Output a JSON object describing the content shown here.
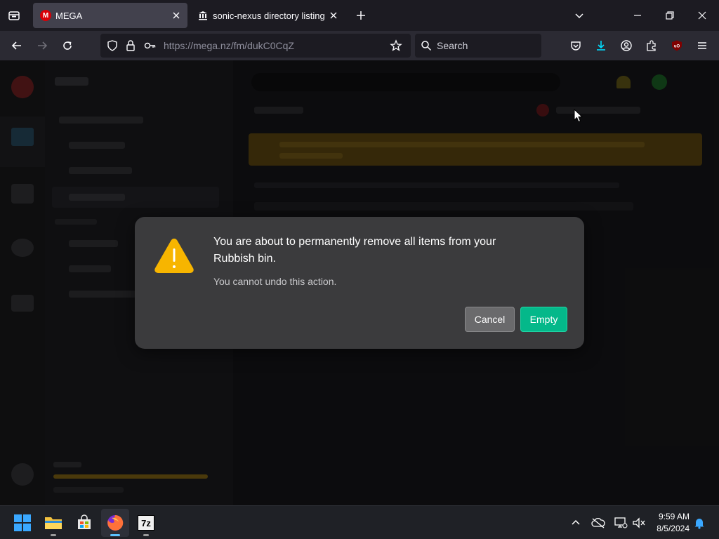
{
  "browser": {
    "tabs": [
      {
        "title": "MEGA",
        "icon": "mega-icon",
        "active": true
      },
      {
        "title": "sonic-nexus directory listing",
        "icon": "library-icon",
        "active": false
      }
    ],
    "url": "https://mega.nz/fm/dukC0CqZ",
    "search_placeholder": "Search"
  },
  "dialog": {
    "title": "You are about to permanently remove all items from your Rubbish bin.",
    "subtitle": "You cannot undo this action.",
    "cancel_label": "Cancel",
    "empty_label": "Empty"
  },
  "taskbar": {
    "time": "9:59 AM",
    "date": "8/5/2024",
    "sevenzip_label": "7z"
  },
  "colors": {
    "accent_green": "#04b88a",
    "warning_yellow": "#f7b500",
    "mega_red": "#d90007"
  }
}
